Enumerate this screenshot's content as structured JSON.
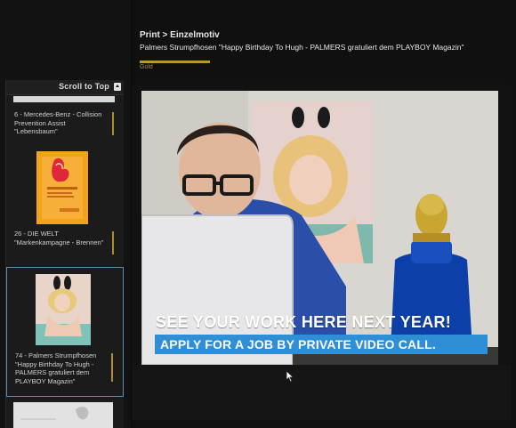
{
  "header": {
    "breadcrumb": "Print > Einzelmotiv",
    "title": "Palmers Strumpfhosen \"Happy Birthday To Hugh - PALMERS gratuliert dem PLAYBOY Magazin\"",
    "award": "Gold",
    "accent_color": "#b9982d"
  },
  "sidebar": {
    "scroll_to_top": "Scroll to Top",
    "items": [
      {
        "label": "6 - Mercedes-Benz - Collision Prevention Assist \"Lebensbaum\""
      },
      {
        "label": "26 - DIE WELT \"Markenkampagne - Brennen\""
      },
      {
        "label": "74 - Palmers Strumpfhosen \"Happy Birthday To Hugh - PALMERS gratuliert dem PLAYBOY Magazin\"",
        "selected": true
      }
    ],
    "selected_color": "#5b8fb2"
  },
  "video": {
    "headline": "SEE YOUR WORK HERE NEXT YEAR!",
    "subline": "APPLY FOR A JOB BY PRIVATE VIDEO CALL.",
    "highlight_color": "#2f8fd6"
  }
}
